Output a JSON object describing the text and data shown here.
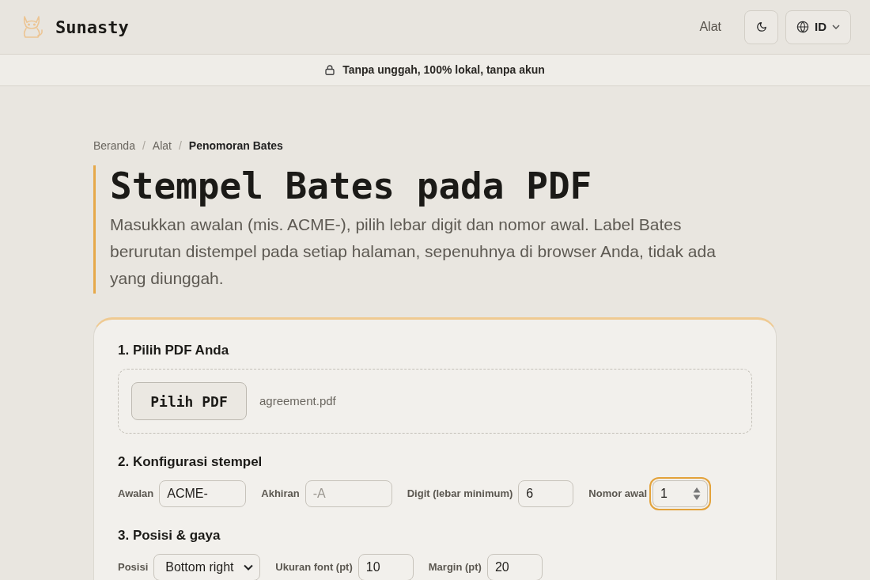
{
  "header": {
    "logo_text": "Sunasty",
    "nav_link": "Alat",
    "language": {
      "label": "ID"
    }
  },
  "banner": {
    "text": "Tanpa unggah, 100% lokal, tanpa akun"
  },
  "breadcrumb": {
    "separator": "/",
    "items": [
      {
        "label": "Beranda",
        "current": false
      },
      {
        "label": "Alat",
        "current": false
      },
      {
        "label": "Penomoran Bates",
        "current": true
      }
    ]
  },
  "title": "Stempel Bates pada PDF",
  "description": "Masukkan awalan (mis. ACME-), pilih lebar digit dan nomor awal. Label Bates berurutan distempel pada setiap halaman, sepenuhnya di browser Anda, tidak ada yang diunggah.",
  "steps": [
    {
      "kind": "file",
      "heading": "1. Pilih PDF Anda",
      "button": "Pilih PDF",
      "file_name": "agreement.pdf"
    },
    {
      "kind": "fields",
      "heading": "2. Konfigurasi stempel",
      "fields": [
        {
          "kind": "text",
          "label": "Awalan",
          "value": "ACME-",
          "focused": false
        },
        {
          "kind": "text",
          "label": "Akhiran",
          "placeholder": "-A",
          "focused": false
        },
        {
          "kind": "number",
          "label": "Digit (lebar minimum)",
          "value": "6",
          "focused": false
        },
        {
          "kind": "number",
          "label": "Nomor awal",
          "value": "1",
          "focused": true
        }
      ]
    },
    {
      "kind": "fields",
      "heading": "3. Posisi & gaya",
      "fields": [
        {
          "kind": "select",
          "label": "Posisi",
          "value": "Bottom right",
          "focused": false
        },
        {
          "kind": "number",
          "label": "Ukuran font (pt)",
          "value": "10",
          "focused": false
        },
        {
          "kind": "number",
          "label": "Margin (pt)",
          "value": "20",
          "focused": false
        }
      ]
    }
  ]
}
